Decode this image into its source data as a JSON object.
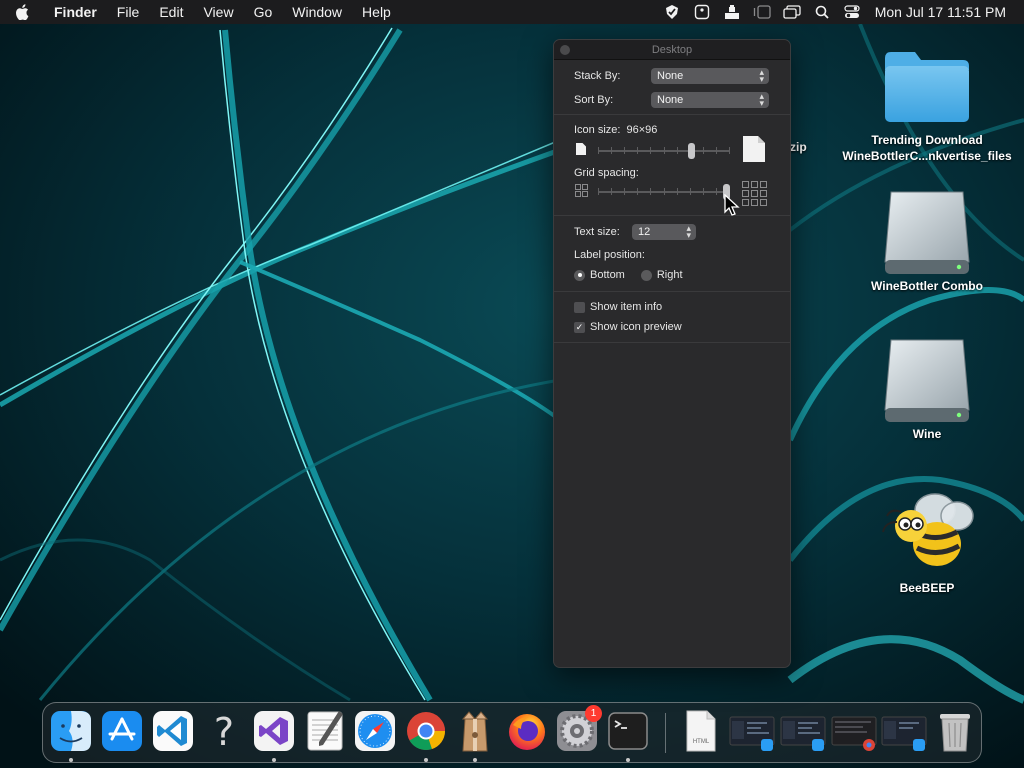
{
  "menubar": {
    "app_name": "Finder",
    "items": [
      "File",
      "Edit",
      "View",
      "Go",
      "Window",
      "Help"
    ],
    "clock": "Mon Jul 17  11:51 PM"
  },
  "desktop_icons": [
    {
      "line1": "Trending Download",
      "line2": "WineBottlerC...nkvertise_files"
    },
    {
      "line1": "WineBottler Combo"
    },
    {
      "line1": "Wine"
    },
    {
      "line1": "BeeBEEP"
    }
  ],
  "partial_label": "zip",
  "panel": {
    "title": "Desktop",
    "stack_by": {
      "label": "Stack By:",
      "value": "None"
    },
    "sort_by": {
      "label": "Sort By:",
      "value": "None"
    },
    "icon_size": {
      "label": "Icon size:",
      "value": "96×96",
      "level": 0.72
    },
    "grid_spacing": {
      "label": "Grid spacing:",
      "level": 1.0
    },
    "text_size": {
      "label": "Text size:",
      "value": "12"
    },
    "label_position": {
      "label": "Label position:",
      "options": [
        "Bottom",
        "Right"
      ],
      "selected": "Bottom"
    },
    "show_item_info": {
      "label": "Show item info",
      "checked": false
    },
    "show_icon_preview": {
      "label": "Show icon preview",
      "checked": true
    }
  },
  "dock": {
    "apps": [
      "finder",
      "app-store",
      "visual-studio-code",
      "help",
      "visual-studio",
      "textedit",
      "safari",
      "chrome",
      "archive-utility",
      "firefox",
      "system-preferences",
      "terminal"
    ],
    "system_preferences_badge": "1",
    "html_doc_label": "HTML"
  }
}
